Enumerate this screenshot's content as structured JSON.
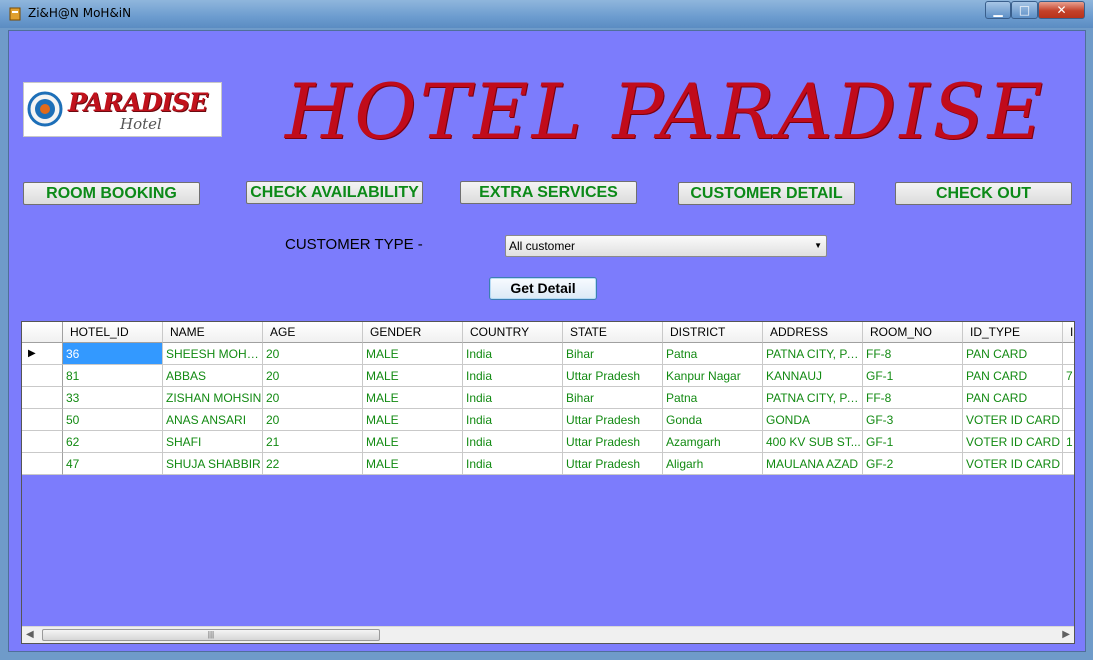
{
  "window": {
    "title": "Zi&H@N MoH&iN"
  },
  "logo": {
    "word": "PARADISE",
    "sub": "Hotel"
  },
  "headline": "HOTEL PARADISE",
  "nav": [
    {
      "label": "ROOM BOOKING"
    },
    {
      "label": "CHECK AVAILABILITY"
    },
    {
      "label": "EXTRA SERVICES"
    },
    {
      "label": "CUSTOMER DETAIL"
    },
    {
      "label": "CHECK OUT"
    }
  ],
  "filter": {
    "label": "CUSTOMER TYPE -",
    "selected": "All customer"
  },
  "get_button": "Get Detail",
  "grid": {
    "columns": [
      "HOTEL_ID",
      "NAME",
      "AGE",
      "GENDER",
      "COUNTRY",
      "STATE",
      "DISTRICT",
      "ADDRESS",
      "ROOM_NO",
      "ID_TYPE",
      "I"
    ],
    "rows": [
      [
        "36",
        "SHEESH MOHSIN",
        "20",
        "MALE",
        "India",
        "Bihar",
        "Patna",
        "PATNA CITY, PA...",
        "FF-8",
        "PAN CARD",
        ""
      ],
      [
        "81",
        "ABBAS",
        "20",
        "MALE",
        "India",
        "Uttar Pradesh",
        "Kanpur Nagar",
        "KANNAUJ",
        "GF-1",
        "PAN CARD",
        "7"
      ],
      [
        "33",
        "ZISHAN MOHSIN",
        "20",
        "MALE",
        "India",
        "Bihar",
        "Patna",
        "PATNA CITY, PA...",
        "FF-8",
        "PAN CARD",
        ""
      ],
      [
        "50",
        "ANAS ANSARI",
        "20",
        "MALE",
        "India",
        "Uttar Pradesh",
        "Gonda",
        "GONDA",
        "GF-3",
        "VOTER ID CARD",
        ""
      ],
      [
        "62",
        "SHAFI",
        "21",
        "MALE",
        "India",
        "Uttar Pradesh",
        "Azamgarh",
        "400 KV SUB ST...",
        "GF-1",
        "VOTER ID CARD",
        "1"
      ],
      [
        "47",
        "SHUJA SHABBIR",
        "22",
        "MALE",
        "India",
        "Uttar Pradesh",
        "Aligarh",
        "MAULANA AZAD",
        "GF-2",
        "VOTER ID CARD",
        ""
      ]
    ]
  },
  "colors": {
    "client_bg": "#7c7cfc",
    "headline": "#c10b1b",
    "nav_text": "#0c8a18",
    "cell_text": "#128a12"
  }
}
